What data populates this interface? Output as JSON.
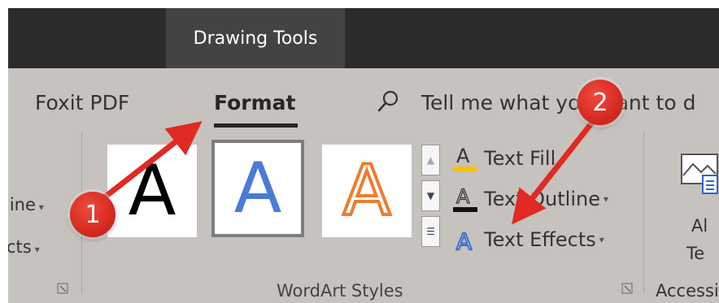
{
  "contextual_tab": {
    "label": "Drawing Tools"
  },
  "ribbon_tabs": {
    "foxit": "Foxit PDF",
    "format": "Format"
  },
  "tell_me": {
    "text": "Tell me what you want to d"
  },
  "left_fragment": {
    "outline": "line",
    "effects": "cts"
  },
  "wordart": {
    "group_label": "WordArt Styles",
    "styles": [
      {
        "glyph": "A",
        "color": "#000000"
      },
      {
        "glyph": "A",
        "color": "#4a7bd8"
      },
      {
        "glyph": "A",
        "color": "#ed7d31"
      }
    ],
    "text_fill": "Text Fill",
    "text_outline": "Text Outline",
    "text_effects": "Text Effects"
  },
  "right_fragment": {
    "group_label": "Accessi",
    "line1": "Al",
    "line2": "Te"
  },
  "annotations": {
    "badge1": "1",
    "badge2": "2",
    "color": "#e02a22"
  },
  "colors": {
    "topbar": "#2b2b2b",
    "ribbon": "#c6c2be",
    "fill_bar": "#ffc000"
  }
}
